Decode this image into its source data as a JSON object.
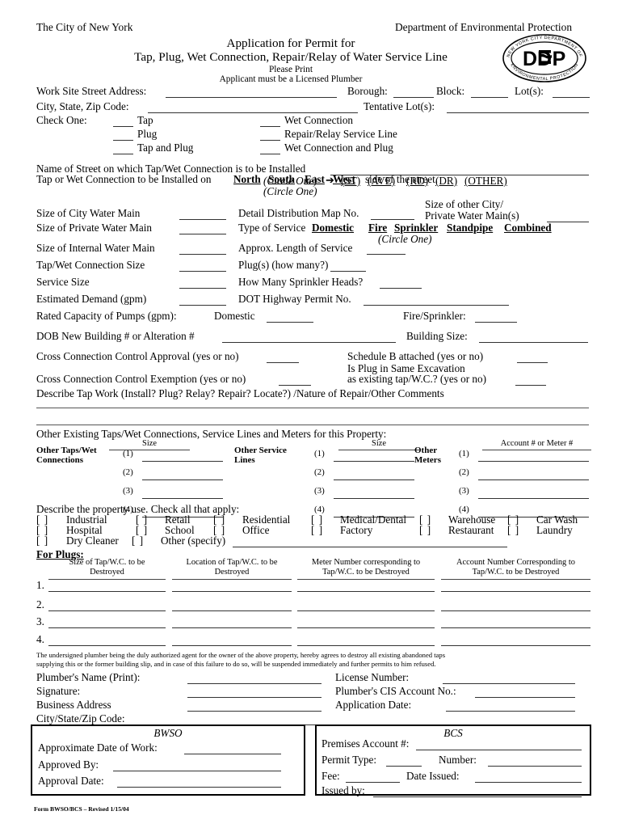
{
  "header": {
    "city": "The City of New York",
    "department": "Department of Environmental Protection",
    "title_line1": "Application for Permit for",
    "title_line2": "Tap, Plug, Wet Connection, Repair/Relay of Water Service Line",
    "please_print": "Please Print",
    "licensed_note": "Applicant must be a Licensed Plumber",
    "logo": {
      "center_text": "DEP",
      "top_arc": "NEW YORK CITY DEPARTMENT OF",
      "bottom_arc": "ENVIRONMENTAL PROTECTION"
    }
  },
  "address": {
    "work_site_label": "Work Site Street Address:",
    "borough_label": "Borough:",
    "block_label": "Block:",
    "lots_label": "Lot(s):",
    "city_state_zip_label": "City, State, Zip Code:",
    "tentative_lots_label": "Tentative Lot(s):"
  },
  "check_one": {
    "label": "Check One:",
    "left_options": [
      "Tap",
      "Plug",
      "Tap and Plug"
    ],
    "right_options": [
      "Wet Connection",
      "Repair/Relay Service Line",
      "Wet Connection and Plug"
    ]
  },
  "street": {
    "name_label": "Name of Street on which Tap/Wet Connection is to be Installed",
    "circle_one": "(Circle One)",
    "arrow": "➔",
    "suffixes": [
      "(ST)",
      "(AVE)",
      "(RD)",
      "(DR)",
      "(OTHER)"
    ],
    "side_prefix": "Tap or Wet Connection to be Installed on",
    "directions": [
      "North",
      "South",
      "East",
      "West"
    ],
    "side_suffix": "side of the street.",
    "side_circle_one": "(Circle One)"
  },
  "specs": {
    "size_city_water_main": "Size of City Water Main",
    "size_private_water_main": "Size of Private Water Main",
    "size_internal_water_main": "Size of Internal Water Main",
    "tap_wet_connection_size": "Tap/Wet Connection Size",
    "service_size": "Service Size",
    "estimated_demand": "Estimated Demand (gpm)",
    "detail_distribution_map": "Detail Distribution Map No.",
    "size_other_city_line1": "Size of other City/",
    "size_other_city_line2": "Private Water Main(s)",
    "type_of_service_label": "Type of Service",
    "type_of_service_options": [
      "Domestic",
      "Fire",
      "Sprinkler",
      "Standpipe",
      "Combined"
    ],
    "type_circle_one": "(Circle One)",
    "approx_length": "Approx. Length of Service",
    "plugs_how_many": "Plug(s) (how many?)",
    "sprinkler_heads": "How Many Sprinkler Heads?",
    "dot_highway_permit": "DOT Highway Permit No.",
    "rated_capacity": "Rated Capacity of Pumps (gpm):",
    "domestic": "Domestic",
    "fire_sprinkler": "Fire/Sprinkler:"
  },
  "building": {
    "dob_label": "DOB New Building # or Alteration #",
    "building_size_label": "Building Size:",
    "cc_approval": "Cross Connection Control Approval (yes or no)",
    "schedule_b": "Schedule B attached (yes or no)",
    "cc_exemption": "Cross Connection Control Exemption (yes or no)",
    "plug_same_excavation_line1": "Is Plug in Same Excavation",
    "plug_same_excavation_line2": "as existing tap/W.C.? (yes or no)",
    "describe_tap_work": "Describe Tap Work (Install? Plug? Relay? Repair? Locate?) /Nature of Repair/Other Comments"
  },
  "other_existing": {
    "heading": "Other Existing Taps/Wet Connections, Service Lines and Meters for this Property:",
    "col1_label_line1": "Other Taps/Wet",
    "col1_label_line2": "Connections",
    "col2_label_line1": "Other Service",
    "col2_label_line2": "Lines",
    "col3_label_line1": "Other",
    "col3_label_line2": "Meters",
    "size_header": "Size",
    "account_header": "Account # or Meter #",
    "row_numbers": [
      "(1)",
      "(2)",
      "(3)",
      "(4)"
    ]
  },
  "property_use": {
    "heading": "Describe the property use. Check all that apply:",
    "row1": [
      "Industrial",
      "Retail",
      "Residential",
      "Medical/Dental",
      "Warehouse",
      "Car Wash"
    ],
    "row2": [
      "Hospital",
      "School",
      "Office",
      "Factory",
      "Restaurant",
      "Laundry"
    ],
    "row3": [
      "Dry Cleaner",
      "Other (specify)"
    ],
    "checkbox_glyph": "[    ]"
  },
  "for_plugs": {
    "heading": "For Plugs:",
    "columns": [
      {
        "line1": "Size of Tap/W.C. to be",
        "line2": "Destroyed"
      },
      {
        "line1": "Location of Tap/W.C. to be",
        "line2": "Destroyed"
      },
      {
        "line1": "Meter Number corresponding to",
        "line2": "Tap/W.C. to be Destroyed"
      },
      {
        "line1": "Account Number Corresponding to",
        "line2": "Tap/W.C. to be Destroyed"
      }
    ],
    "row_numbers": [
      "1.",
      "2.",
      "3.",
      "4."
    ]
  },
  "affidavit": {
    "line1": "The undersigned plumber being the duly authorized agent for the owner of the above property, hereby agrees to destroy all existing abandoned taps",
    "line2": "supplying this or the former building slip, and in case of this failure to do so, will be suspended immediately and further permits to him refused."
  },
  "signature": {
    "plumber_name": "Plumber's Name (Print):",
    "signature": "Signature:",
    "business_address": "Business Address",
    "city_state_zip": "City/State/Zip Code:",
    "license_number": "License Number:",
    "cis_account": "Plumber's CIS Account No.:",
    "application_date": "Application Date:"
  },
  "bwso": {
    "title": "BWSO",
    "approx_date": "Approximate Date of Work:",
    "approved_by": "Approved By:",
    "approval_date": "Approval Date:"
  },
  "bcs": {
    "title": "BCS",
    "premises_account": "Premises Account #:",
    "permit_type": "Permit Type:",
    "number": "Number:",
    "fee": "Fee:",
    "date_issued": "Date Issued:",
    "issued_by": "Issued by:"
  },
  "footer": {
    "form_id": "Form BWSO/BCS – Revised 1/15/04"
  }
}
